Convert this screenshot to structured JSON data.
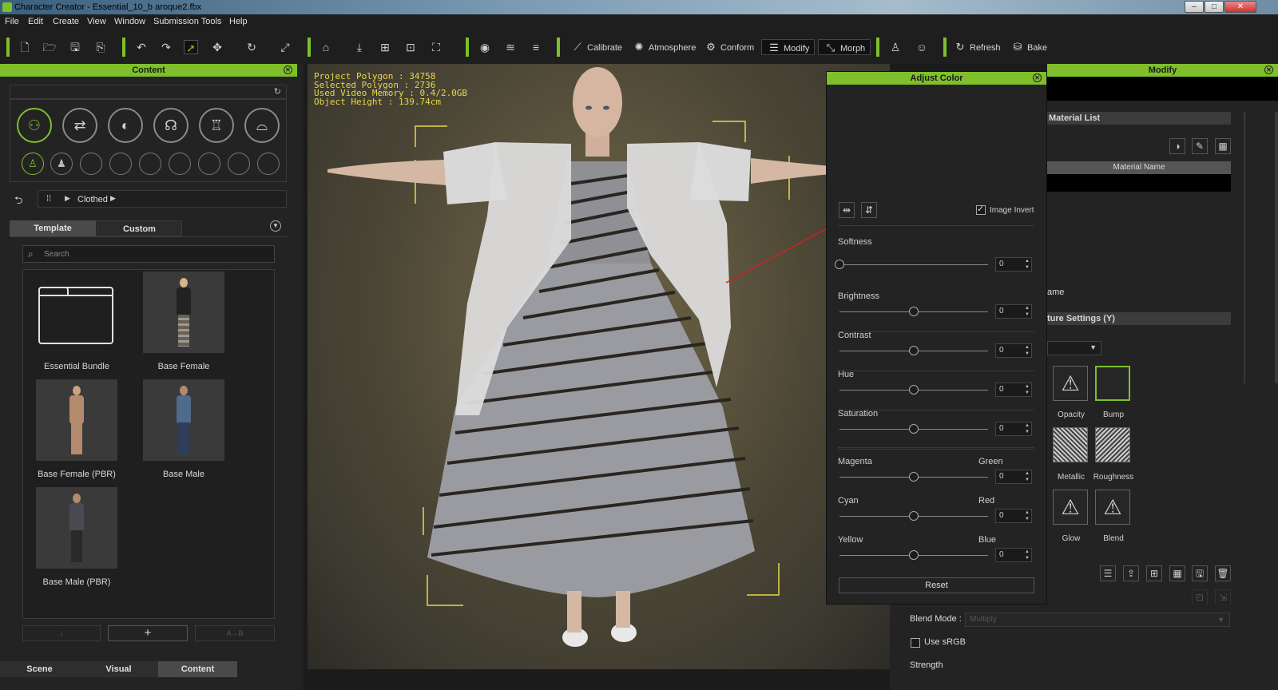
{
  "window": {
    "title": "Character Creator - Essential_10_b aroque2.fbx",
    "controls": [
      "–",
      "□",
      "✕"
    ]
  },
  "menu": [
    "File",
    "Edit",
    "Create",
    "View",
    "Window",
    "Submission Tools",
    "Help"
  ],
  "toolbar": {
    "buttons": [
      {
        "label": "Calibrate",
        "icon": "calibrate-icon"
      },
      {
        "label": "Atmosphere",
        "icon": "atmosphere-icon"
      },
      {
        "label": "Conform",
        "icon": "conform-icon"
      },
      {
        "label": "Modify",
        "icon": "modify-icon"
      },
      {
        "label": "Morph",
        "icon": "morph-icon"
      },
      {
        "label": "Refresh",
        "icon": "refresh-icon"
      },
      {
        "label": "Bake",
        "icon": "bake-icon"
      }
    ],
    "active": "Modify"
  },
  "content_panel": {
    "title": "Content",
    "breadcrumb": "Clothed",
    "tabs": [
      "Template",
      "Custom"
    ],
    "active_tab": "Template",
    "search_placeholder": "Search",
    "items": [
      {
        "label": "Essential Bundle",
        "kind": "folder"
      },
      {
        "label": "Base Female",
        "kind": "female"
      },
      {
        "label": "Base Female (PBR)",
        "kind": "female-pbr"
      },
      {
        "label": "Base Male",
        "kind": "male"
      },
      {
        "label": "Base Male (PBR)",
        "kind": "male-pbr"
      }
    ],
    "bottom_tabs": [
      "Scene",
      "Visual",
      "Content"
    ],
    "active_bottom_tab": "Content"
  },
  "viewport": {
    "stats": [
      "Project Polygon : 34758",
      "Selected Polygon : 2736",
      "Used Video Memory : 0.4/2.0GB",
      "Object Height : 139.74cm"
    ]
  },
  "adjust_color": {
    "title": "Adjust Color",
    "image_invert_label": "Image Invert",
    "image_invert_checked": true,
    "sliders": [
      {
        "label": "Softness",
        "right_label": "",
        "value": "0",
        "level": 0.0
      },
      {
        "label": "Brightness",
        "right_label": "",
        "value": "0",
        "level": 0.5
      },
      {
        "label": "Contrast",
        "right_label": "",
        "value": "0",
        "level": 0.5
      },
      {
        "label": "Hue",
        "right_label": "",
        "value": "0",
        "level": 0.5
      },
      {
        "label": "Saturation",
        "right_label": "",
        "value": "0",
        "level": 0.5
      },
      {
        "label": "Magenta",
        "right_label": "Green",
        "value": "0",
        "level": 0.5
      },
      {
        "label": "Cyan",
        "right_label": "Red",
        "value": "0",
        "level": 0.5
      },
      {
        "label": "Yellow",
        "right_label": "Blue",
        "value": "0",
        "level": 0.5
      }
    ],
    "reset_label": "Reset"
  },
  "modify_panel": {
    "title": "Modify",
    "material_list_label": "Material List",
    "material_name_header": "Material Name",
    "name_label_partial": "ame",
    "texture_settings_partial": "ture Settings  (Y)",
    "texture_slots": [
      {
        "label": "Opacity",
        "icon": "warning-icon"
      },
      {
        "label": "Bump",
        "icon": "empty-slot"
      },
      {
        "label": "Metallic",
        "icon": "noise-texture"
      },
      {
        "label": "Roughness",
        "icon": "noise-texture"
      },
      {
        "label": "Glow",
        "icon": "warning-icon"
      },
      {
        "label": "Blend",
        "icon": "warning-icon"
      }
    ],
    "blend_mode_label": "Blend Mode :",
    "blend_mode_value": "Multiply",
    "use_srgb_label": "Use sRGB",
    "strength_label": "Strength"
  },
  "colors": {
    "accent": "#7fbf2b",
    "stats_text": "#e8d84a",
    "panel_bg": "#232323",
    "arrow": "#d42020"
  }
}
